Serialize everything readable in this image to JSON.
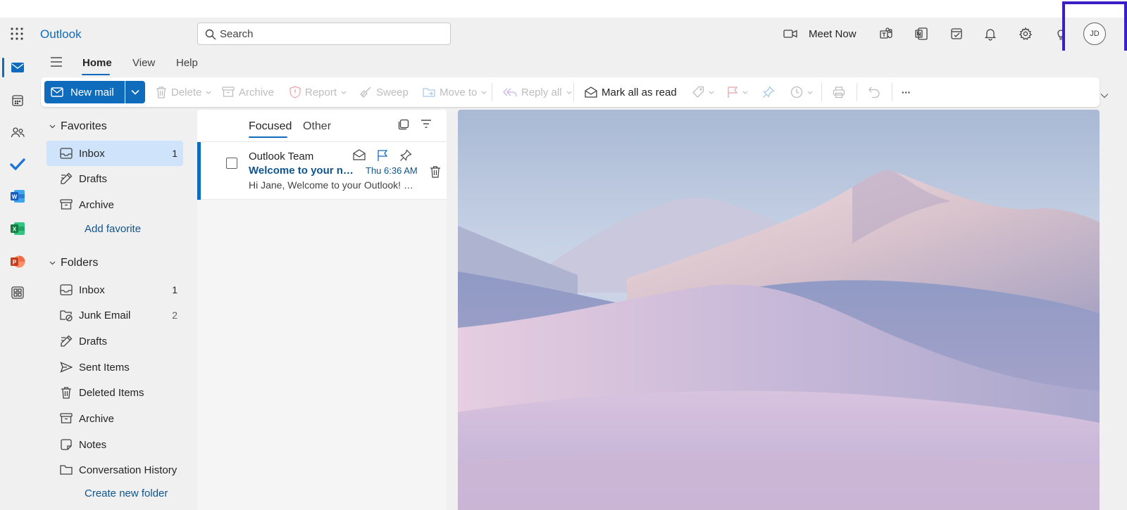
{
  "app": {
    "name": "Outlook"
  },
  "search": {
    "placeholder": "Search"
  },
  "header": {
    "meet_now_label": "Meet Now",
    "avatar_initials": "JD"
  },
  "tabs": [
    {
      "label": "Home"
    },
    {
      "label": "View"
    },
    {
      "label": "Help"
    }
  ],
  "ribbon": {
    "new_mail": "New mail",
    "delete": "Delete",
    "archive": "Archive",
    "report": "Report",
    "sweep": "Sweep",
    "move_to": "Move to",
    "reply_all": "Reply all",
    "mark_all_read": "Mark all as read",
    "more": "···"
  },
  "nav": {
    "favorites_label": "Favorites",
    "favorites": [
      {
        "label": "Inbox",
        "count": "1",
        "icon": "inbox-icon"
      },
      {
        "label": "Drafts",
        "count": "",
        "icon": "drafts-icon"
      },
      {
        "label": "Archive",
        "count": "",
        "icon": "archive-icon"
      }
    ],
    "add_favorite": "Add favorite",
    "folders_label": "Folders",
    "folders": [
      {
        "label": "Inbox",
        "count": "1",
        "icon": "inbox-icon"
      },
      {
        "label": "Junk Email",
        "count": "2",
        "icon": "junk-icon"
      },
      {
        "label": "Drafts",
        "count": "",
        "icon": "drafts-icon"
      },
      {
        "label": "Sent Items",
        "count": "",
        "icon": "send-icon"
      },
      {
        "label": "Deleted Items",
        "count": "",
        "icon": "trash-icon"
      },
      {
        "label": "Archive",
        "count": "",
        "icon": "archive-icon"
      },
      {
        "label": "Notes",
        "count": "",
        "icon": "notes-icon"
      },
      {
        "label": "Conversation History",
        "count": "",
        "icon": "folder-icon"
      }
    ],
    "create_folder": "Create new folder"
  },
  "message_list": {
    "tabs": [
      "Focused",
      "Other"
    ],
    "messages": [
      {
        "sender": "Outlook Team",
        "subject": "Welcome to your new Outlook.com account",
        "time": "Thu 6:36 AM",
        "preview": "Hi Jane, Welcome to your Outlook! We're excited you're here."
      }
    ]
  },
  "colors": {
    "accent": "#0f6cbd",
    "selection": "#cfe4fa",
    "highlight_box": "#3b1ec5"
  }
}
